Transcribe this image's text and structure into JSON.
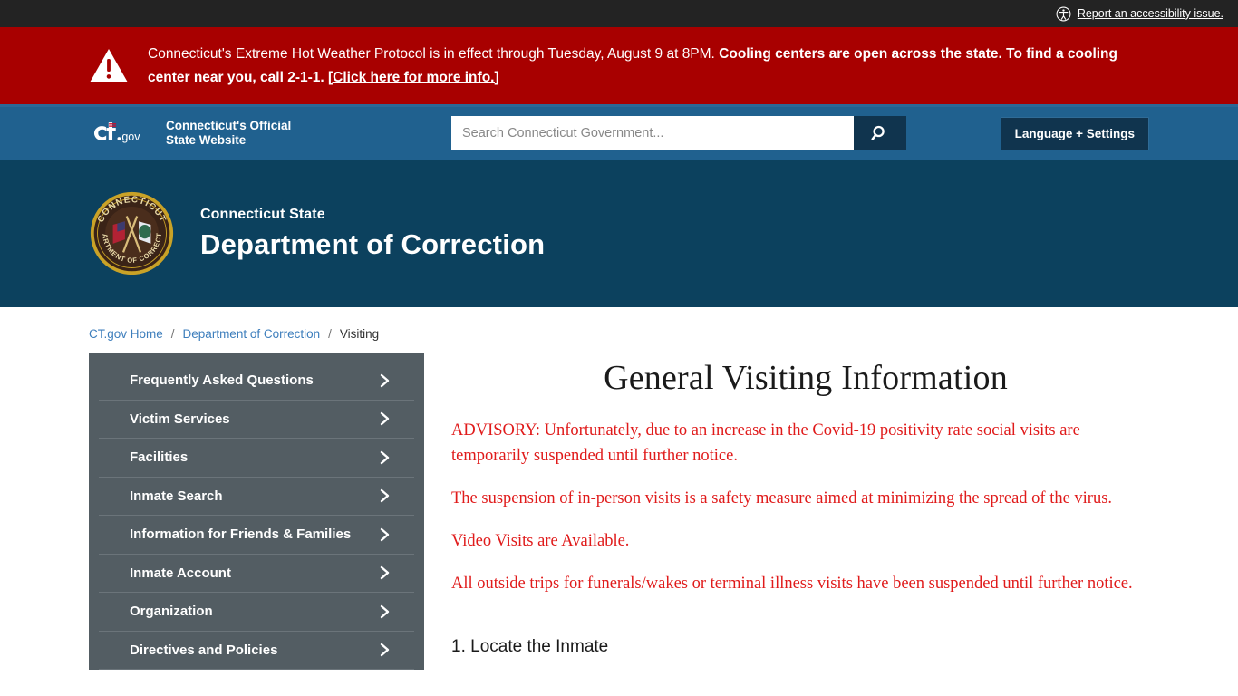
{
  "topbar": {
    "accessibility_icon": "accessibility-icon",
    "accessibility_label": "Report an accessibility issue."
  },
  "alert": {
    "icon": "warning-triangle-icon",
    "text_1": "Connecticut's Extreme Hot Weather Protocol is in effect through Tuesday, August 9 at 8PM. ",
    "text_bold": "Cooling centers are open across the state. To find a cooling center near you, call 2-1-1. ",
    "link_text": "[Click here for more info.]",
    "background": "#a80000"
  },
  "ctnav": {
    "logo_text": "Ct.gov",
    "tagline_line1": "Connecticut's Official",
    "tagline_line2": "State Website",
    "search_placeholder": "Search Connecticut Government...",
    "search_value": "",
    "search_icon": "search-icon",
    "language_button": "Language + Settings",
    "background": "#20618f"
  },
  "agency": {
    "seal_icon": "department-of-correction-seal",
    "seal_text_top": "CONNECTICUT",
    "seal_text_bottom": "DEPARTMENT OF CORRECTION",
    "supertitle": "Connecticut State",
    "title": "Department of Correction",
    "background": "#0c415e"
  },
  "breadcrumb": {
    "items": [
      {
        "label": "CT.gov Home",
        "link": true
      },
      {
        "label": "Department of Correction",
        "link": true
      },
      {
        "label": "Visiting",
        "link": false
      }
    ],
    "separator": "/"
  },
  "sidebar": {
    "background": "#535d63",
    "items": [
      {
        "label": "Frequently Asked Questions",
        "icon": "chevron-right-icon"
      },
      {
        "label": "Victim Services",
        "icon": "chevron-right-icon"
      },
      {
        "label": "Facilities",
        "icon": "chevron-right-icon"
      },
      {
        "label": "Inmate Search",
        "icon": "chevron-right-icon"
      },
      {
        "label": "Information for Friends & Families",
        "icon": "chevron-right-icon"
      },
      {
        "label": "Inmate Account",
        "icon": "chevron-right-icon"
      },
      {
        "label": "Organization",
        "icon": "chevron-right-icon"
      },
      {
        "label": "Directives and Policies",
        "icon": "chevron-right-icon"
      }
    ]
  },
  "main": {
    "title": "General Visiting Information",
    "advisory_color": "#e01b1b",
    "advisories": [
      "ADVISORY:  Unfortunately, due to an increase in the Covid-19 positivity rate social visits are temporarily suspended until further notice.",
      "The suspension of in-person visits is a safety measure aimed at minimizing the spread of the virus.",
      "Video Visits are Available.",
      "All outside trips for funerals/wakes or terminal illness visits have been suspended until further notice."
    ],
    "step_1": "1. Locate the Inmate"
  }
}
